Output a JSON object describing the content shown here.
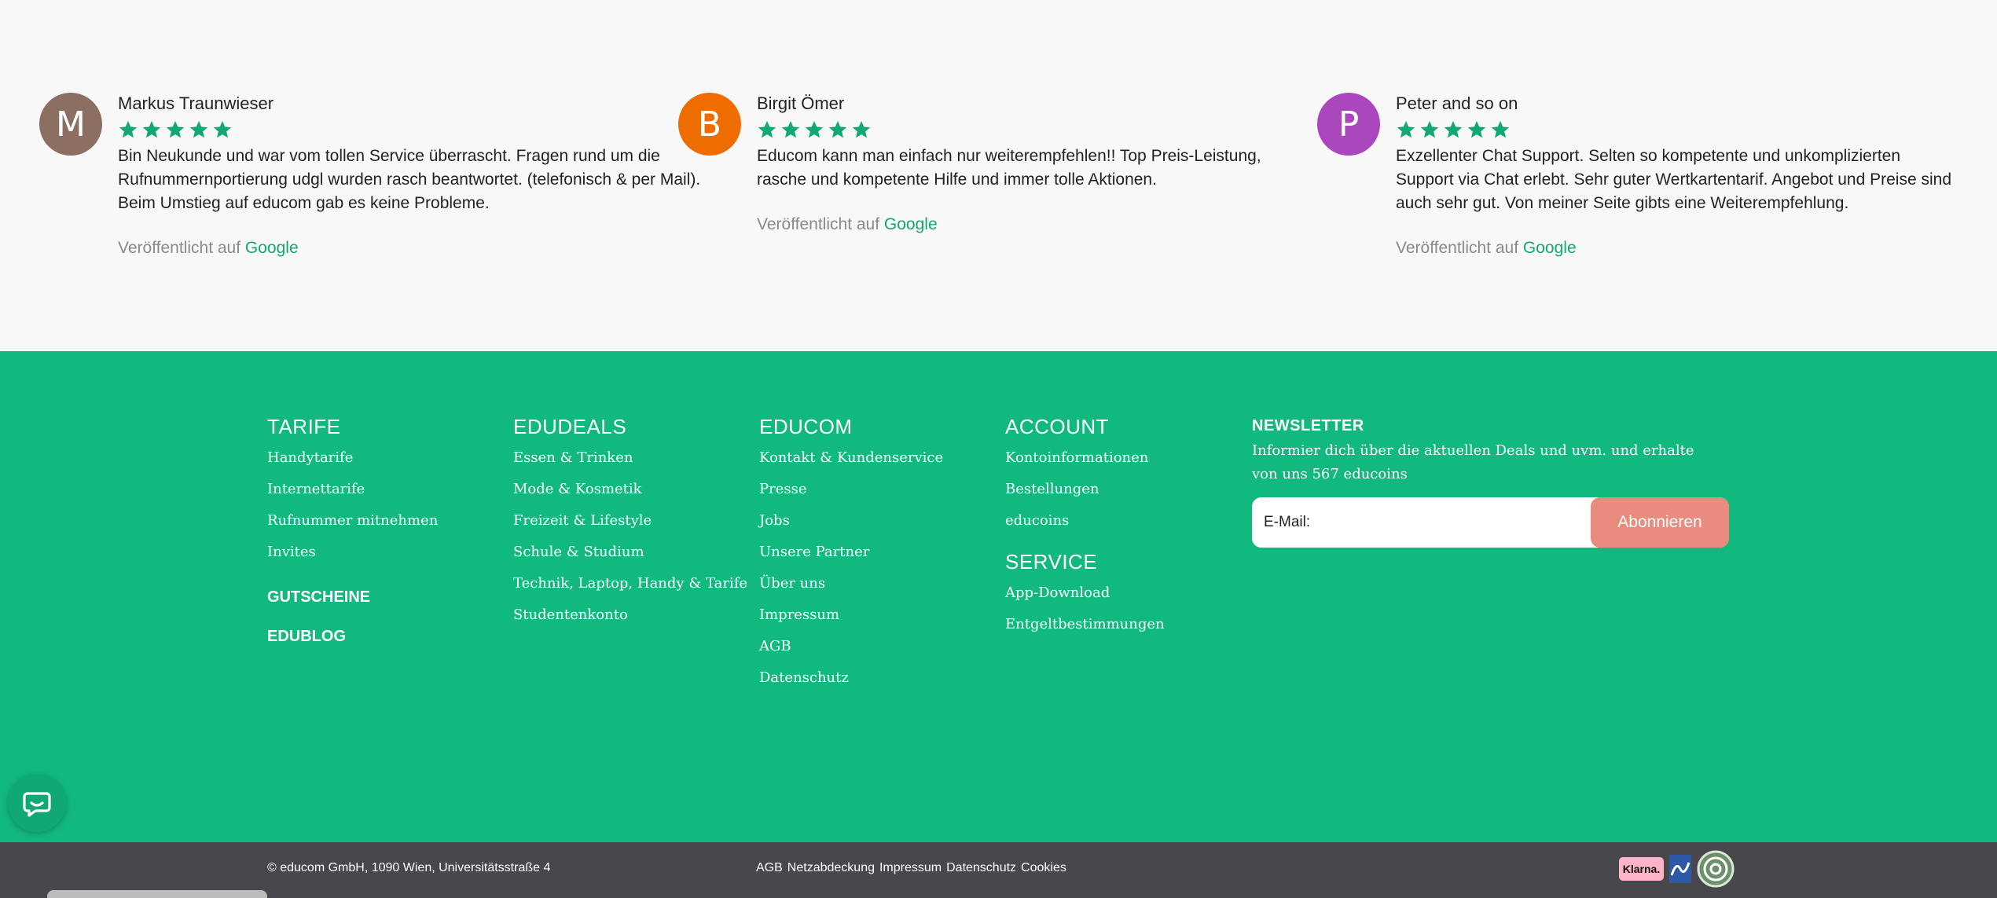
{
  "reviews": [
    {
      "initial": "M",
      "avatar_color": "#8d6e63",
      "name": "Markus Traunwieser",
      "rating": 5,
      "text": "Bin Neukunde und war vom tollen Service überrascht. Fragen rund um die Rufnummernportierung udgl wurden rasch beantwortet. (telefonisch & per Mail). Beim Umstieg auf educom gab es keine Probleme.",
      "published_prefix": "Veröffentlicht auf",
      "published_source": "Google"
    },
    {
      "initial": "B",
      "avatar_color": "#ef6c00",
      "name": "Birgit Ömer",
      "rating": 5,
      "text": "Educom kann man einfach nur weiterempfehlen!! Top Preis-Leistung, rasche und kompetente Hilfe und immer tolle Aktionen.",
      "published_prefix": "Veröffentlicht auf",
      "published_source": "Google"
    },
    {
      "initial": "P",
      "avatar_color": "#ab47bc",
      "name": "Peter and so on",
      "rating": 5,
      "text": "Exzellenter Chat Support. Selten so kompetente und unkomplizierten Support via Chat erlebt. Sehr guter Wertkartentarif. Angebot und Preise sind auch sehr gut. Von meiner Seite gibts eine Weiterempfehlung.",
      "published_prefix": "Veröffentlicht auf",
      "published_source": "Google"
    }
  ],
  "footer": {
    "tarife": {
      "heading": "TARIFE",
      "links": [
        "Handytarife",
        "Internettarife",
        "Rufnummer mitnehmen",
        "Invites"
      ],
      "extra": [
        "GUTSCHEINE",
        "EDUBLOG"
      ]
    },
    "edudeals": {
      "heading": "EDUDEALS",
      "links": [
        "Essen & Trinken",
        "Mode & Kosmetik",
        "Freizeit & Lifestyle",
        "Schule & Studium",
        "Technik, Laptop, Handy & Tarife",
        "Studentenkonto"
      ]
    },
    "educom": {
      "heading": "EDUCOM",
      "links": [
        "Kontakt & Kundenservice",
        "Presse",
        "Jobs",
        "Unsere Partner",
        "Über uns",
        "Impressum",
        "AGB",
        "Datenschutz"
      ]
    },
    "account": {
      "heading": "ACCOUNT",
      "links": [
        "Kontoinformationen",
        "Bestellungen",
        "educoins"
      ]
    },
    "service": {
      "heading": "SERVICE",
      "links": [
        "App-Download",
        "Entgeltbestimmungen"
      ]
    },
    "newsletter": {
      "heading": "NEWSLETTER",
      "text": "Informier dich über die aktuellen Deals und uvm. und erhalte von uns 567 educoins",
      "placeholder": "E-Mail:",
      "button": "Abonnieren"
    }
  },
  "bottom_bar": {
    "copyright": "© educom GmbH, 1090 Wien, Universitätsstraße 4",
    "links": [
      "AGB",
      "Netzabdeckung",
      "Impressum",
      "Datenschutz",
      "Cookies"
    ],
    "klarna_label": "Klarna."
  },
  "colors": {
    "brand_green": "#12b97e",
    "star_green": "#13a872",
    "button_salmon": "#e98b7d",
    "bottom_bar": "#48484c"
  }
}
